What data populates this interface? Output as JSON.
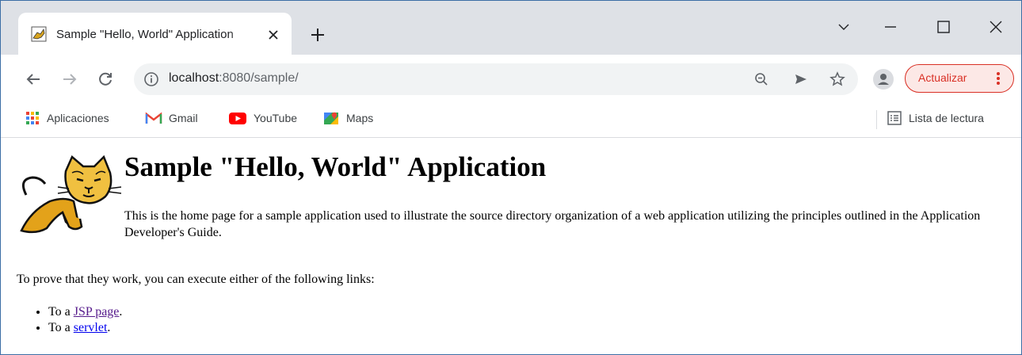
{
  "browser": {
    "tab": {
      "title": "Sample \"Hello, World\" Application",
      "favicon": "tomcat-favicon",
      "close_icon": "close-icon"
    },
    "new_tab_icon": "plus-icon",
    "window_controls": [
      "chevron-down-icon",
      "minimize-icon",
      "maximize-icon",
      "close-icon"
    ],
    "nav": [
      "back-arrow-icon",
      "forward-arrow-icon",
      "reload-icon"
    ],
    "omnibox": {
      "host": "localhost",
      "rest": ":8080/sample/",
      "info_icon": "info-icon"
    },
    "omnibox_icons": [
      "zoom-out-icon",
      "send-icon",
      "star-icon"
    ],
    "profile_icon": "person-icon",
    "update_button": {
      "label": "Actualizar",
      "color": "#d93025"
    },
    "bookmarks": [
      {
        "label": "Aplicaciones",
        "icon": "apps-grid-icon"
      },
      {
        "label": "Gmail",
        "icon": "gmail-icon"
      },
      {
        "label": "YouTube",
        "icon": "youtube-icon"
      },
      {
        "label": "Maps",
        "icon": "maps-icon"
      }
    ],
    "reading_list": {
      "label": "Lista de lectura",
      "icon": "reading-list-icon"
    }
  },
  "page": {
    "title": "Sample \"Hello, World\" Application",
    "intro": "This is the home page for a sample application used to illustrate the source directory organization of a web application utilizing the principles outlined in the Application Developer's Guide.",
    "prove": "To prove that they work, you can execute either of the following links:",
    "links": [
      {
        "prefix": "To a ",
        "link": "JSP page",
        "suffix": "."
      },
      {
        "prefix": "To a ",
        "link": "servlet",
        "suffix": "."
      }
    ]
  }
}
